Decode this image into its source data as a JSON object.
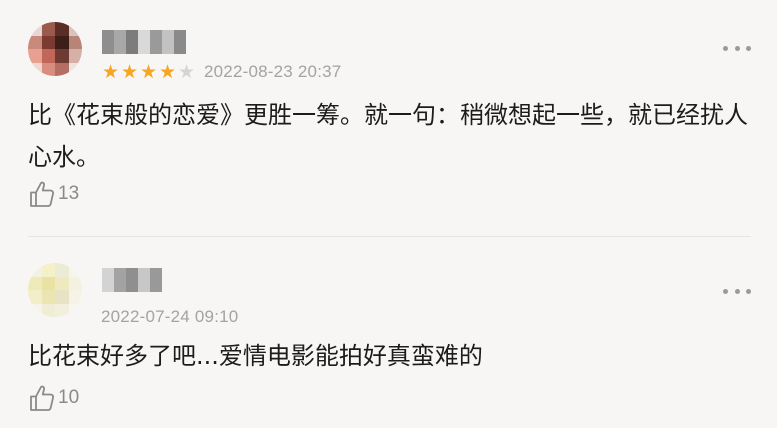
{
  "comments": [
    {
      "rating": 4,
      "rating_max": 5,
      "timestamp": "2022-08-23 20:37",
      "text": "比《花束般的恋爱》更胜一筹。就一句：稍微想起一些，就已经扰人心水。",
      "likes": "13",
      "star_full": "★",
      "star_empty": "★"
    },
    {
      "timestamp": "2022-07-24 09:10",
      "text": "比花束好多了吧...爱情电影能拍好真蛮难的",
      "likes": "10"
    }
  ],
  "colors": {
    "star_on": "#f5a623",
    "star_off": "#d6d4d0",
    "muted_text": "#a3a3a3",
    "background": "#f7f6f4"
  },
  "icons": {
    "more": "more-dots-icon",
    "like": "thumbs-up-icon"
  }
}
